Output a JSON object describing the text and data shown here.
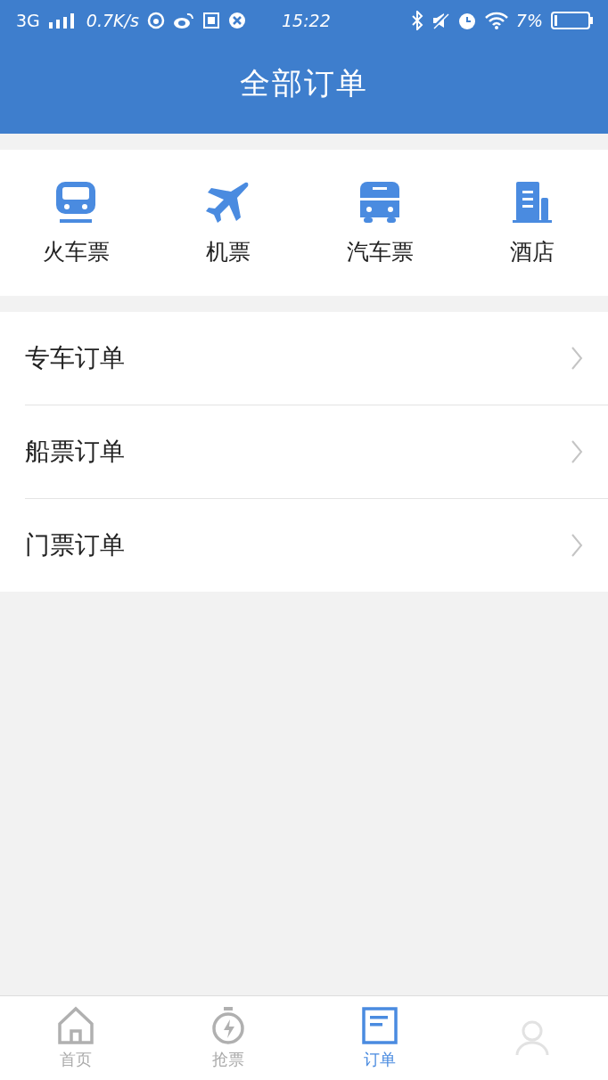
{
  "status_bar": {
    "network": "3G",
    "speed": "0.7K/s",
    "time": "15:22",
    "battery": "7%"
  },
  "header": {
    "title": "全部订单"
  },
  "categories": [
    {
      "kind": "train",
      "label": "火车票"
    },
    {
      "kind": "plane",
      "label": "机票"
    },
    {
      "kind": "bus",
      "label": "汽车票"
    },
    {
      "kind": "hotel",
      "label": "酒店"
    }
  ],
  "order_rows": [
    {
      "label": "专车订单"
    },
    {
      "label": "船票订单"
    },
    {
      "label": "门票订单"
    }
  ],
  "tab_bar": [
    {
      "kind": "home",
      "label": "首页",
      "selected": false
    },
    {
      "kind": "grab",
      "label": "抢票",
      "selected": false
    },
    {
      "kind": "orders",
      "label": "订单",
      "selected": true
    },
    {
      "kind": "profile",
      "selected": false
    }
  ]
}
